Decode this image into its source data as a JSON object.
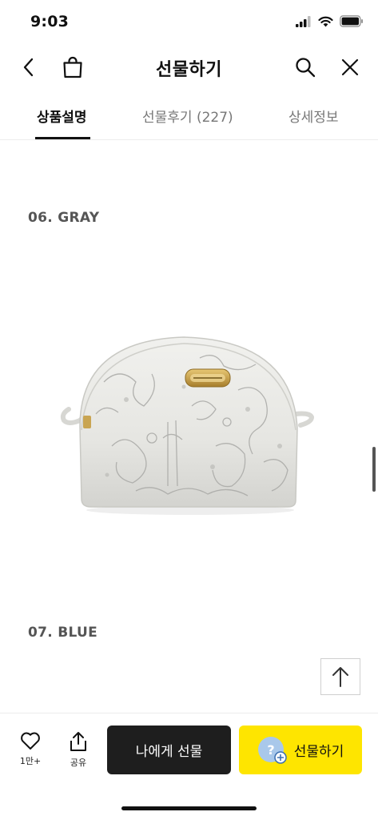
{
  "status_bar": {
    "time": "9:03"
  },
  "header": {
    "title": "선물하기",
    "icons": {
      "back": "chevron-left-icon",
      "cart": "shopping-bag-icon",
      "search": "search-icon",
      "close": "close-icon"
    }
  },
  "tabs": [
    {
      "label": "상품설명",
      "active": true
    },
    {
      "label": "선물후기 (227)",
      "active": false
    },
    {
      "label": "상세정보",
      "active": false
    }
  ],
  "content": {
    "sections": [
      {
        "label": "06. GRAY",
        "image": "gray-toile-pouch"
      },
      {
        "label": "07. BLUE"
      }
    ]
  },
  "bottom_bar": {
    "like_label": "1만+",
    "share_label": "공유",
    "self_gift_label": "나에게 선물",
    "gift_label": "선물하기"
  },
  "colors": {
    "gift_button": "#fee500",
    "self_gift_button": "#1e1e1e",
    "section_label": "#555555"
  }
}
